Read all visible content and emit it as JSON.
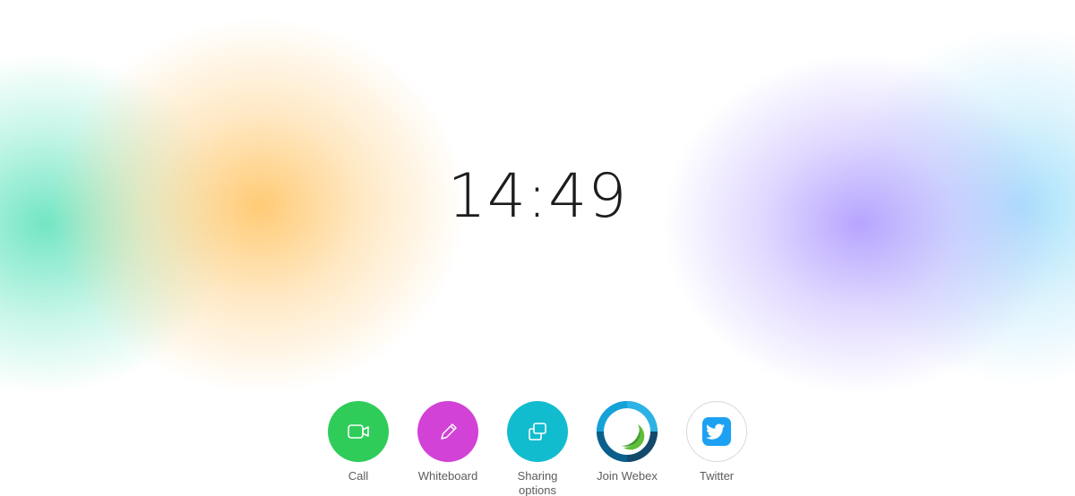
{
  "clock": {
    "time": "14:49"
  },
  "dock": {
    "items": [
      {
        "label": "Call",
        "icon": "video-camera-icon",
        "color": "#2fcc5a"
      },
      {
        "label": "Whiteboard",
        "icon": "pencil-icon",
        "color": "#d242d6"
      },
      {
        "label": "Sharing options",
        "icon": "share-screens-icon",
        "color": "#12bccf"
      },
      {
        "label": "Join Webex",
        "icon": "webex-logo-icon",
        "color": "#1a4f7a"
      },
      {
        "label": "Twitter",
        "icon": "twitter-bird-icon",
        "color": "#1da1f2"
      }
    ]
  },
  "background": {
    "blobs": [
      "#5ae1b9",
      "#ffc86e",
      "#b4a0ff",
      "#96dcfa"
    ]
  }
}
